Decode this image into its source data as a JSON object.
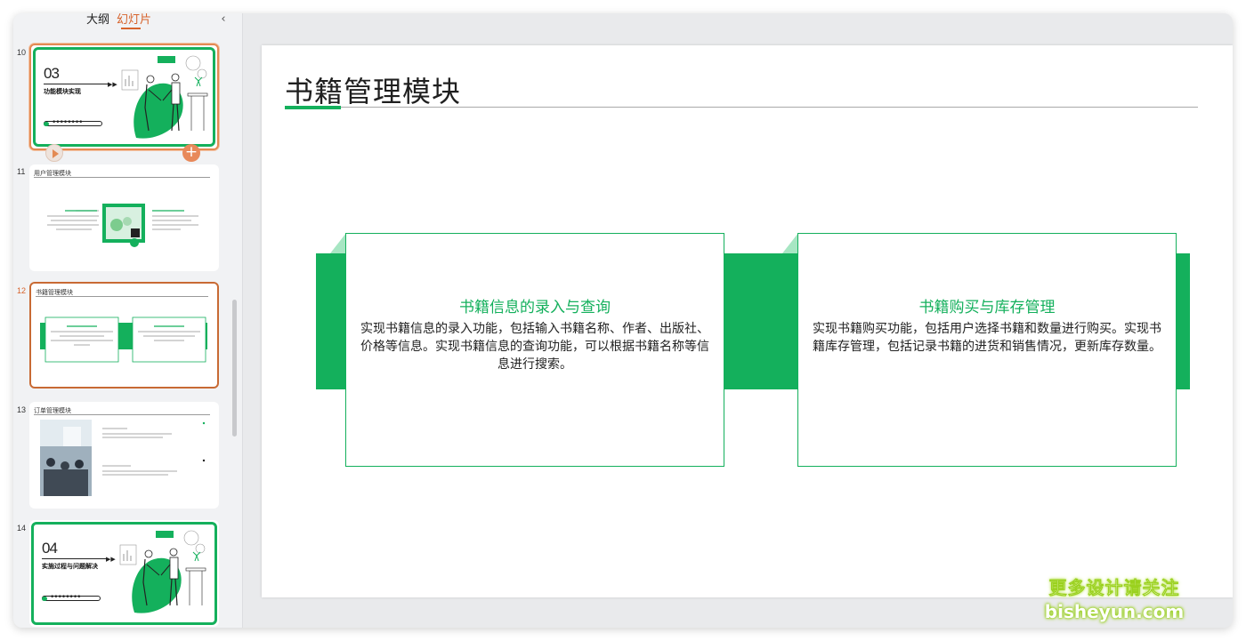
{
  "tabs": {
    "outline": "大纲",
    "slides": "幻灯片"
  },
  "collapse_icon": "‹",
  "thumbnails": [
    {
      "num": "10",
      "big_num": "03",
      "subtitle": "功能模块实现"
    },
    {
      "num": "11",
      "title": "用户管理模块"
    },
    {
      "num": "12",
      "title": "书籍管理模块"
    },
    {
      "num": "13",
      "title": "订单管理模块"
    },
    {
      "num": "14",
      "big_num": "04",
      "subtitle": "实施过程与问题解决"
    }
  ],
  "slide": {
    "title": "书籍管理模块",
    "cards": [
      {
        "heading": "书籍信息的录入与查询",
        "body": "实现书籍信息的录入功能，包括输入书籍名称、作者、出版社、价格等信息。实现书籍信息的查询功能，可以根据书籍名称等信息进行搜索。"
      },
      {
        "heading": "书籍购买与库存管理",
        "body": "实现书籍购买功能，包括用户选择书籍和数量进行购买。实现书籍库存管理，包括记录书籍的进货和销售情况，更新库存数量。"
      }
    ]
  },
  "watermark": {
    "line1": "更多设计请关注",
    "line2": "bisheyun.com"
  },
  "colors": {
    "accent": "#14b05c",
    "selection": "#d7632c"
  }
}
